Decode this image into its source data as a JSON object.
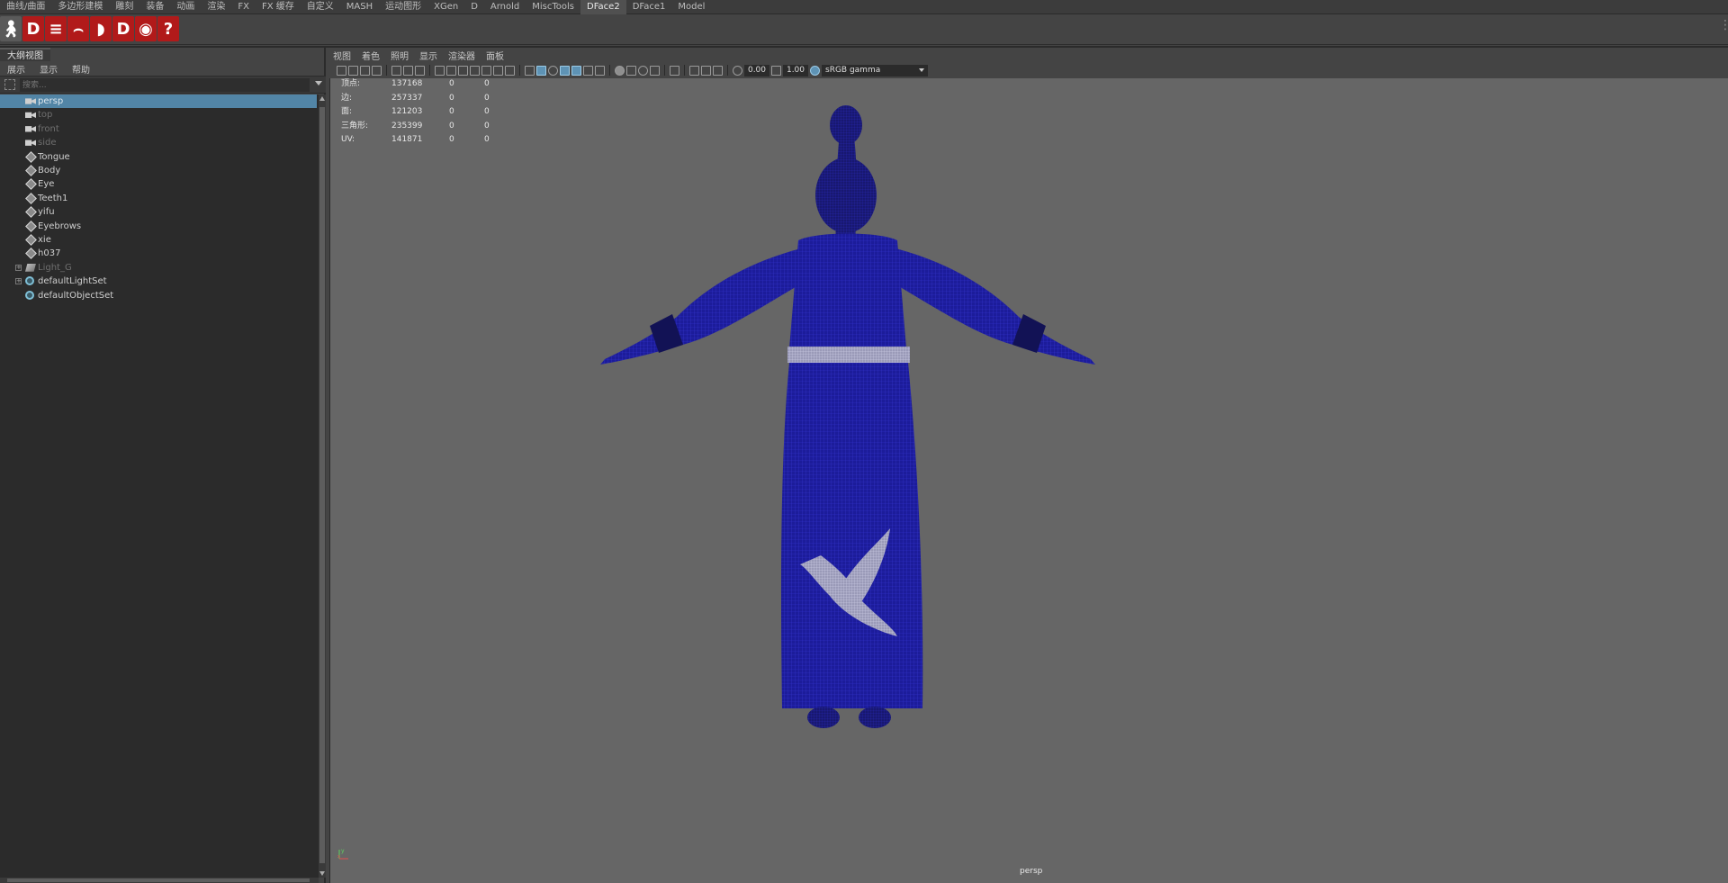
{
  "shelf_tabs": [
    "曲线/曲面",
    "多边形建模",
    "雕刻",
    "装备",
    "动画",
    "渲染",
    "FX",
    "FX 缓存",
    "自定义",
    "MASH",
    "运动图形",
    "XGen",
    "D",
    "Arnold",
    "MiscTools",
    "DFace2",
    "DFace1",
    "Model"
  ],
  "active_shelf_tab": "DFace2",
  "shelf_icons": [
    "figure-icon",
    "d-logo-icon",
    "lines-icon",
    "curve-icon",
    "lips-icon",
    "d-mouth-icon",
    "d-badge-icon",
    "help-icon"
  ],
  "outliner": {
    "title": "大纲视图",
    "menu": [
      "展示",
      "显示",
      "帮助"
    ],
    "search_placeholder": "搜索...",
    "items": [
      {
        "label": "persp",
        "type": "camera",
        "selected": true,
        "dim": false,
        "expandable": false
      },
      {
        "label": "top",
        "type": "camera",
        "selected": false,
        "dim": true,
        "expandable": false
      },
      {
        "label": "front",
        "type": "camera",
        "selected": false,
        "dim": true,
        "expandable": false
      },
      {
        "label": "side",
        "type": "camera",
        "selected": false,
        "dim": true,
        "expandable": false
      },
      {
        "label": "Tongue",
        "type": "mesh",
        "selected": false,
        "dim": false,
        "expandable": false
      },
      {
        "label": "Body",
        "type": "mesh",
        "selected": false,
        "dim": false,
        "expandable": false
      },
      {
        "label": "Eye",
        "type": "mesh",
        "selected": false,
        "dim": false,
        "expandable": false
      },
      {
        "label": "Teeth1",
        "type": "mesh",
        "selected": false,
        "dim": false,
        "expandable": false
      },
      {
        "label": "yifu",
        "type": "mesh",
        "selected": false,
        "dim": false,
        "expandable": false
      },
      {
        "label": "Eyebrows",
        "type": "mesh",
        "selected": false,
        "dim": false,
        "expandable": false
      },
      {
        "label": "xie",
        "type": "mesh",
        "selected": false,
        "dim": false,
        "expandable": false
      },
      {
        "label": "h037",
        "type": "mesh",
        "selected": false,
        "dim": false,
        "expandable": false
      },
      {
        "label": "Light_G",
        "type": "light",
        "selected": false,
        "dim": true,
        "expandable": true
      },
      {
        "label": "defaultLightSet",
        "type": "set",
        "selected": false,
        "dim": false,
        "expandable": true
      },
      {
        "label": "defaultObjectSet",
        "type": "set",
        "selected": false,
        "dim": false,
        "expandable": false
      }
    ]
  },
  "viewport": {
    "menu": [
      "视图",
      "着色",
      "照明",
      "显示",
      "渲染器",
      "面板"
    ],
    "exposure": "0.00",
    "gamma": "1.00",
    "color_space": "sRGB gamma",
    "camera_label": "persp",
    "axis_y": "y",
    "axis_x": "x",
    "hud": [
      {
        "label": "顶点:",
        "v1": "137168",
        "v2": "0",
        "v3": "0"
      },
      {
        "label": "边:",
        "v1": "257337",
        "v2": "0",
        "v3": "0"
      },
      {
        "label": "面:",
        "v1": "121203",
        "v2": "0",
        "v3": "0"
      },
      {
        "label": "三角形:",
        "v1": "235399",
        "v2": "0",
        "v3": "0"
      },
      {
        "label": "UV:",
        "v1": "141871",
        "v2": "0",
        "v3": "0"
      }
    ]
  },
  "colors": {
    "viewport_bg": "#666666",
    "selection": "#5285a6",
    "shelf_red": "#b11a1a",
    "wireframe": "#1a1aa8"
  }
}
